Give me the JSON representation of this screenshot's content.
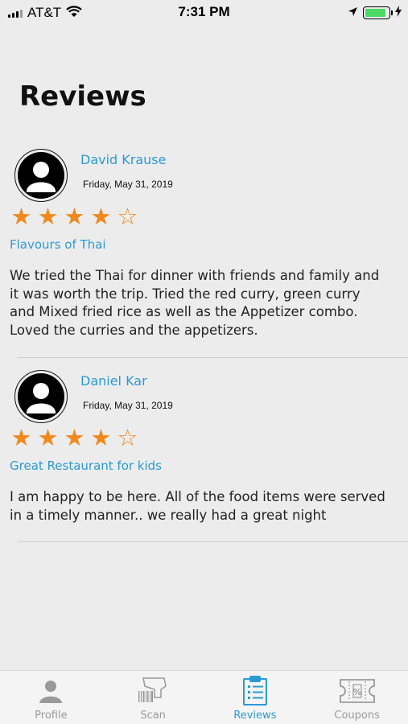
{
  "status_bar": {
    "carrier": "AT&T",
    "time": "7:31 PM",
    "battery_level": 0.9
  },
  "page": {
    "title": "Reviews"
  },
  "reviews": [
    {
      "author": "David Krause",
      "date": "Friday, May 31, 2019",
      "rating": 4,
      "max_rating": 5,
      "title": "Flavours of Thai",
      "body": "We tried the Thai for dinner with friends and family and it was worth the trip. Tried the red curry, green curry and Mixed fried rice as well as the Appetizer combo. Loved the curries and the appetizers."
    },
    {
      "author": "Daniel Kar",
      "date": "Friday, May 31, 2019",
      "rating": 4,
      "max_rating": 5,
      "title": "Great Restaurant for kids",
      "body": "I am happy to be here. All of the food items were served in a timely manner.. we really had a great night"
    }
  ],
  "tabs": [
    {
      "label": "Profile",
      "icon": "person-icon",
      "active": false
    },
    {
      "label": "Scan",
      "icon": "barcode-scanner-icon",
      "active": false
    },
    {
      "label": "Reviews",
      "icon": "clipboard-list-icon",
      "active": true
    },
    {
      "label": "Coupons",
      "icon": "coupon-icon",
      "active": false
    }
  ],
  "colors": {
    "accent": "#2a9ad6",
    "star": "#f0891d",
    "inactive_tab": "#9a9a9a",
    "background": "#ececec"
  }
}
